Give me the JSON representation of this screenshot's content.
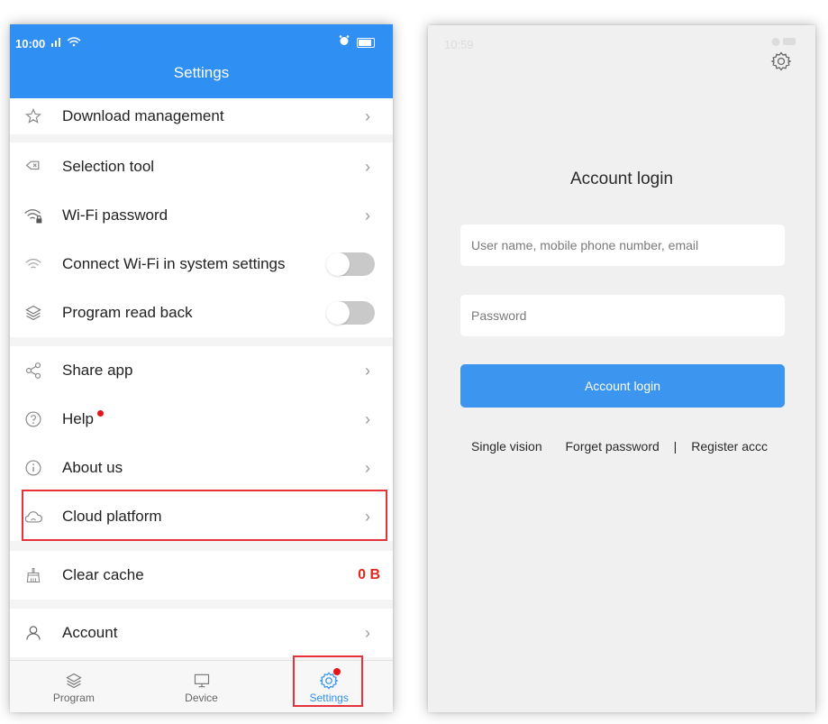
{
  "left_screen": {
    "status": {
      "time": "10:00",
      "signal": "··│ ≈"
    },
    "title": "Settings",
    "rows": {
      "download": "Download management",
      "selection": "Selection tool",
      "wifi_password": "Wi-Fi password",
      "connect_wifi": "Connect Wi-Fi in system settings",
      "program_read_back": "Program read back",
      "share": "Share app",
      "help": "Help",
      "about": "About us",
      "cloud": "Cloud platform",
      "clear_cache": "Clear cache",
      "clear_cache_value": "0 B",
      "account": "Account"
    },
    "toggles": {
      "connect_wifi": false,
      "program_read_back": false
    },
    "nav": {
      "program": "Program",
      "device": "Device",
      "settings": "Settings"
    },
    "chevron": "›"
  },
  "right_screen": {
    "status": {
      "time": "10:59"
    },
    "title": "Account login",
    "username_placeholder": "User name, mobile phone number, email",
    "password_placeholder": "Password",
    "login_button": "Account login",
    "link_single": "Single vision",
    "link_forget": "Forget password",
    "link_sep": "|",
    "link_register": "Register accc"
  },
  "colors": {
    "accent": "#2f8ff3",
    "badge": "#e5141b",
    "highlight": "#e5323b",
    "value": "#e7261b"
  }
}
